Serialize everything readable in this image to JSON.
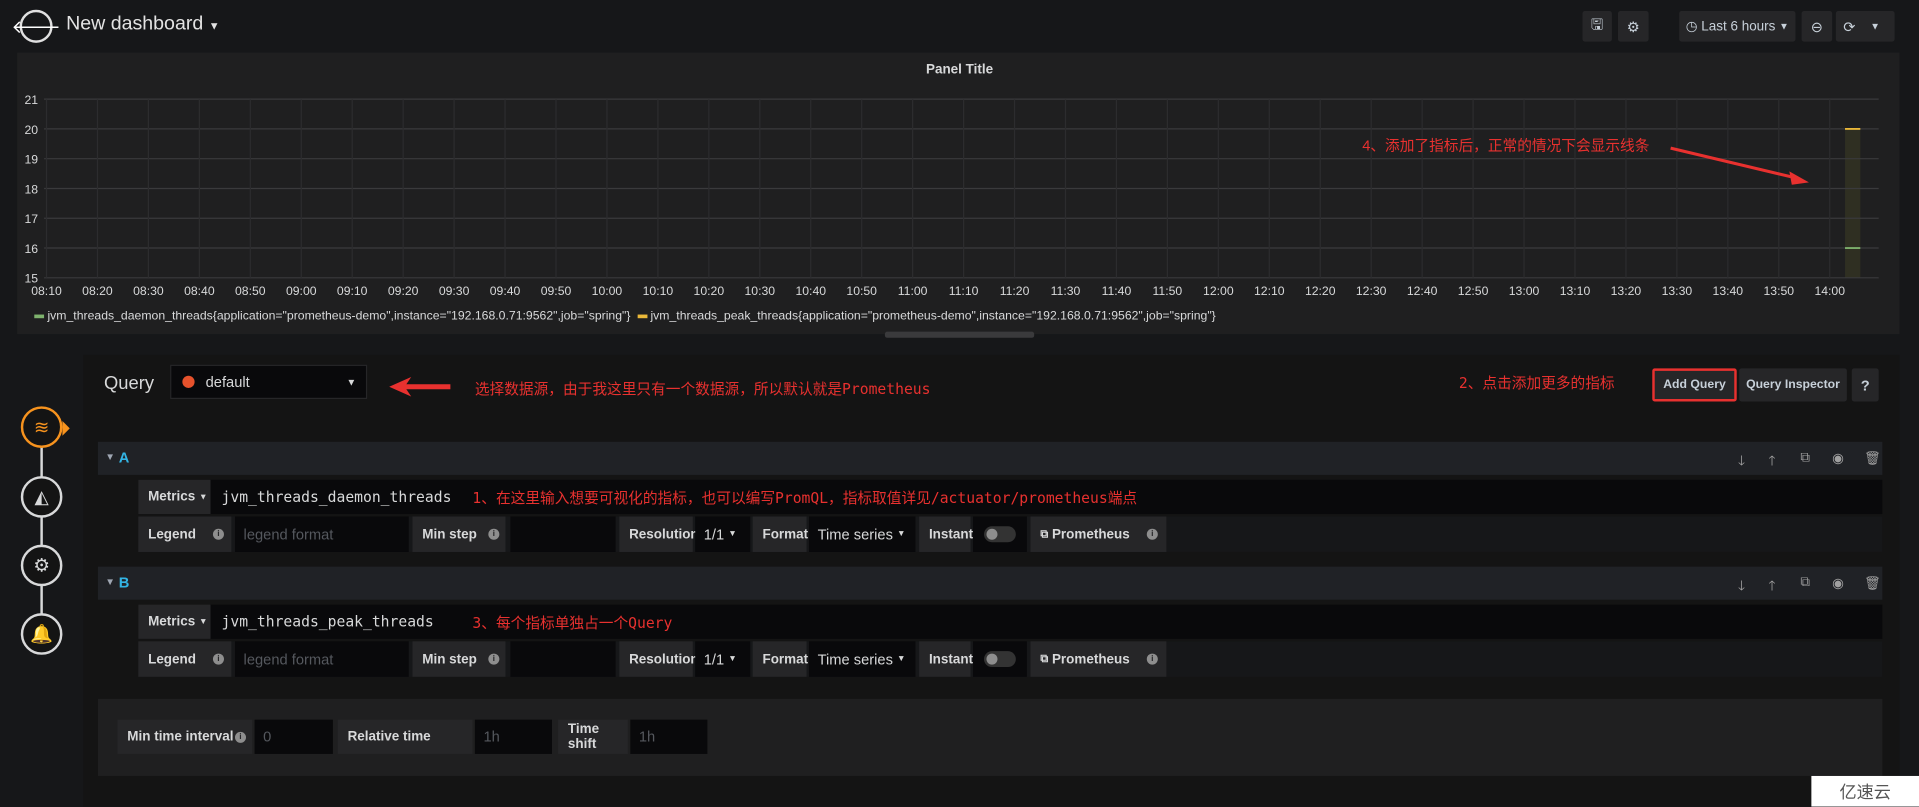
{
  "header": {
    "title": "New dashboard",
    "time_range": "Last 6 hours",
    "icons": [
      "back-arrow-icon",
      "save-icon",
      "gear-icon",
      "clock-icon",
      "zoom-out-icon",
      "refresh-icon"
    ]
  },
  "panel": {
    "title": "Panel Title",
    "annotation": "4、添加了指标后，正常的情况下会显示线条"
  },
  "chart_data": {
    "type": "line",
    "title": "Panel Title",
    "ylim": [
      15,
      21
    ],
    "yticks": [
      "15",
      "16",
      "17",
      "18",
      "19",
      "20",
      "21"
    ],
    "xticks": [
      "08:10",
      "08:20",
      "08:30",
      "08:40",
      "08:50",
      "09:00",
      "09:10",
      "09:20",
      "09:30",
      "09:40",
      "09:50",
      "10:00",
      "10:10",
      "10:20",
      "10:30",
      "10:40",
      "10:50",
      "11:00",
      "11:10",
      "11:20",
      "11:30",
      "11:40",
      "11:50",
      "12:00",
      "12:10",
      "12:20",
      "12:30",
      "12:40",
      "12:50",
      "13:00",
      "13:10",
      "13:20",
      "13:30",
      "13:40",
      "13:50",
      "14:00"
    ],
    "grid": true,
    "legend": "bottom",
    "series": [
      {
        "name": "jvm_threads_daemon_threads{application=\"prometheus-demo\",instance=\"192.168.0.71:9562\",job=\"spring\"}",
        "color": "#7eb26d",
        "x": [
          "14:03",
          "14:06"
        ],
        "values": [
          16,
          16
        ]
      },
      {
        "name": "jvm_threads_peak_threads{application=\"prometheus-demo\",instance=\"192.168.0.71:9562\",job=\"spring\"}",
        "color": "#eab839",
        "x": [
          "14:03",
          "14:06"
        ],
        "values": [
          20,
          20
        ]
      }
    ]
  },
  "query": {
    "label": "Query",
    "datasource": "default",
    "annotation_ds": "选择数据源，由于我这里只有一个数据源，所以默认就是Prometheus",
    "annotation_add": "2、点击添加更多的指标",
    "add_query": "Add Query",
    "query_inspector": "Query Inspector",
    "help": "?"
  },
  "queries": [
    {
      "ref": "A",
      "metrics_label": "Metrics",
      "metrics": "jvm_threads_daemon_threads",
      "annotation": "1、在这里输入想要可视化的指标，也可以编写PromQL，指标取值详见/actuator/prometheus端点",
      "legend_label": "Legend",
      "legend_placeholder": "legend format",
      "min_step": "Min step",
      "resolution_label": "Resolution",
      "resolution": "1/1",
      "format_label": "Format",
      "format": "Time series",
      "instant": "Instant",
      "prometheus": "Prometheus"
    },
    {
      "ref": "B",
      "metrics_label": "Metrics",
      "metrics": "jvm_threads_peak_threads",
      "annotation": "3、每个指标单独占一个Query",
      "legend_label": "Legend",
      "legend_placeholder": "legend format",
      "min_step": "Min step",
      "resolution_label": "Resolution",
      "resolution": "1/1",
      "format_label": "Format",
      "format": "Time series",
      "instant": "Instant",
      "prometheus": "Prometheus"
    }
  ],
  "options": {
    "min_interval_label": "Min time interval",
    "min_interval_placeholder": "0",
    "relative_label": "Relative time",
    "relative_placeholder": "1h",
    "shift_label": "Time shift",
    "shift_placeholder": "1h"
  },
  "watermark": "亿速云"
}
